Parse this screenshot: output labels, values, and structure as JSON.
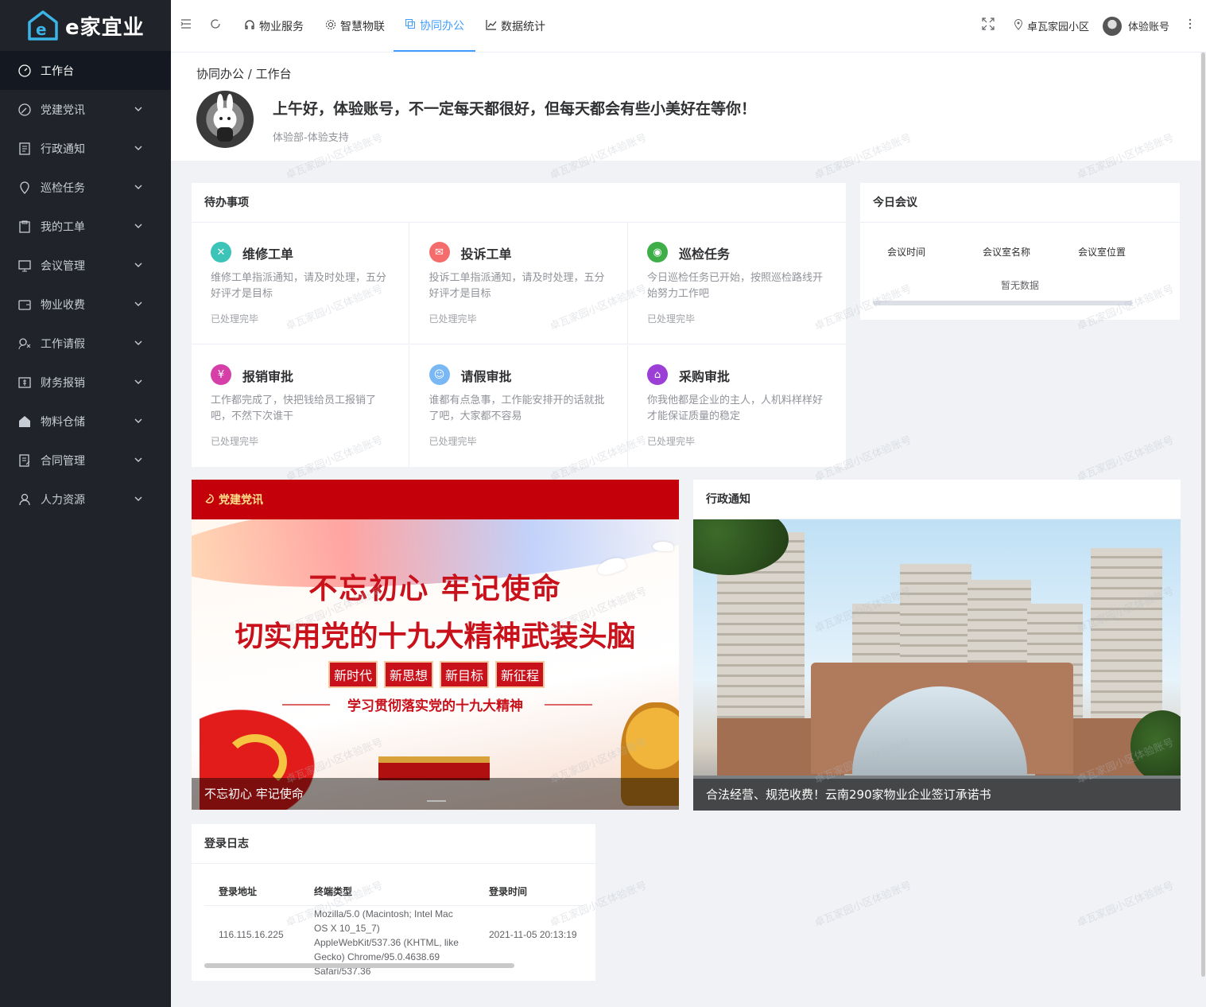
{
  "brand": {
    "logo_text": "e家宜业"
  },
  "sidebar": {
    "items": [
      {
        "label": "工作台",
        "icon": "dashboard-icon"
      },
      {
        "label": "党建党讯",
        "icon": "party-icon"
      },
      {
        "label": "行政通知",
        "icon": "document-icon"
      },
      {
        "label": "巡检任务",
        "icon": "location-icon"
      },
      {
        "label": "我的工单",
        "icon": "clipboard-icon"
      },
      {
        "label": "会议管理",
        "icon": "monitor-icon"
      },
      {
        "label": "物业收费",
        "icon": "wallet-icon"
      },
      {
        "label": "工作请假",
        "icon": "leave-icon"
      },
      {
        "label": "财务报销",
        "icon": "money-icon"
      },
      {
        "label": "物料仓储",
        "icon": "warehouse-icon"
      },
      {
        "label": "合同管理",
        "icon": "contract-icon"
      },
      {
        "label": "人力资源",
        "icon": "user-icon"
      }
    ]
  },
  "header": {
    "tabs": [
      {
        "label": "物业服务",
        "icon": "headset-icon"
      },
      {
        "label": "智慧物联",
        "icon": "gear-icon"
      },
      {
        "label": "协同办公",
        "icon": "copy-icon"
      },
      {
        "label": "数据统计",
        "icon": "chart-icon"
      }
    ],
    "community": "卓瓦家园小区",
    "account": "体验账号"
  },
  "welcome": {
    "breadcrumb": "协同办公 / 工作台",
    "greeting": "上午好，体验账号，不一定每天都很好，但每天都会有些小美好在等你！",
    "department": "体验部-体验支持"
  },
  "todo": {
    "title": "待办事项",
    "items": [
      {
        "name": "维修工单",
        "desc": "维修工单指派通知，请及时处理，五分好评才是目标",
        "status": "已处理完毕",
        "color": "#3cc4b8",
        "icon": "tools-icon"
      },
      {
        "name": "投诉工单",
        "desc": "投诉工单指派通知，请及时处理，五分好评才是目标",
        "status": "已处理完毕",
        "color": "#f56c6c",
        "icon": "complaint-icon"
      },
      {
        "name": "巡检任务",
        "desc": "今日巡检任务已开始，按照巡检路线开始努力工作吧",
        "status": "已处理完毕",
        "color": "#3fae49",
        "icon": "location-icon"
      },
      {
        "name": "报销审批",
        "desc": "工作都完成了，快把钱给员工报销了吧，不然下次谁干",
        "status": "已处理完毕",
        "color": "#d63fa8",
        "icon": "money-icon"
      },
      {
        "name": "请假审批",
        "desc": "谁都有点急事，工作能安排开的话就批了吧，大家都不容易",
        "status": "已处理完毕",
        "color": "#7ab8f5",
        "icon": "leave-icon"
      },
      {
        "name": "采购审批",
        "desc": "你我他都是企业的主人，人机料样样好才能保证质量的稳定",
        "status": "已处理完毕",
        "color": "#9b3fd6",
        "icon": "home-icon"
      }
    ]
  },
  "meeting": {
    "title": "今日会议",
    "columns": [
      "会议时间",
      "会议室名称",
      "会议室位置"
    ],
    "empty_text": "暂无数据"
  },
  "party": {
    "title": "党建党讯",
    "line1": "不忘初心  牢记使命",
    "line2": "切实用党的十九大精神武装头脑",
    "tags": [
      "新时代",
      "新思想",
      "新目标",
      "新征程"
    ],
    "line3": "学习贯彻落实党的十九大精神",
    "caption": "不忘初心 牢记使命"
  },
  "notice": {
    "title": "行政通知",
    "caption": "合法经营、规范收费！云南290家物业企业签订承诺书"
  },
  "login_log": {
    "title": "登录日志",
    "columns": [
      "登录地址",
      "终端类型",
      "登录时间"
    ],
    "rows": [
      {
        "ip": "116.115.16.225",
        "agent": "Mozilla/5.0 (Macintosh; Intel Mac OS X 10_15_7) AppleWebKit/537.36 (KHTML, like Gecko) Chrome/95.0.4638.69 Safari/537.36",
        "time": "2021-11-05 20:13:19"
      }
    ]
  },
  "watermark_text": "卓瓦家园小区体验账号"
}
